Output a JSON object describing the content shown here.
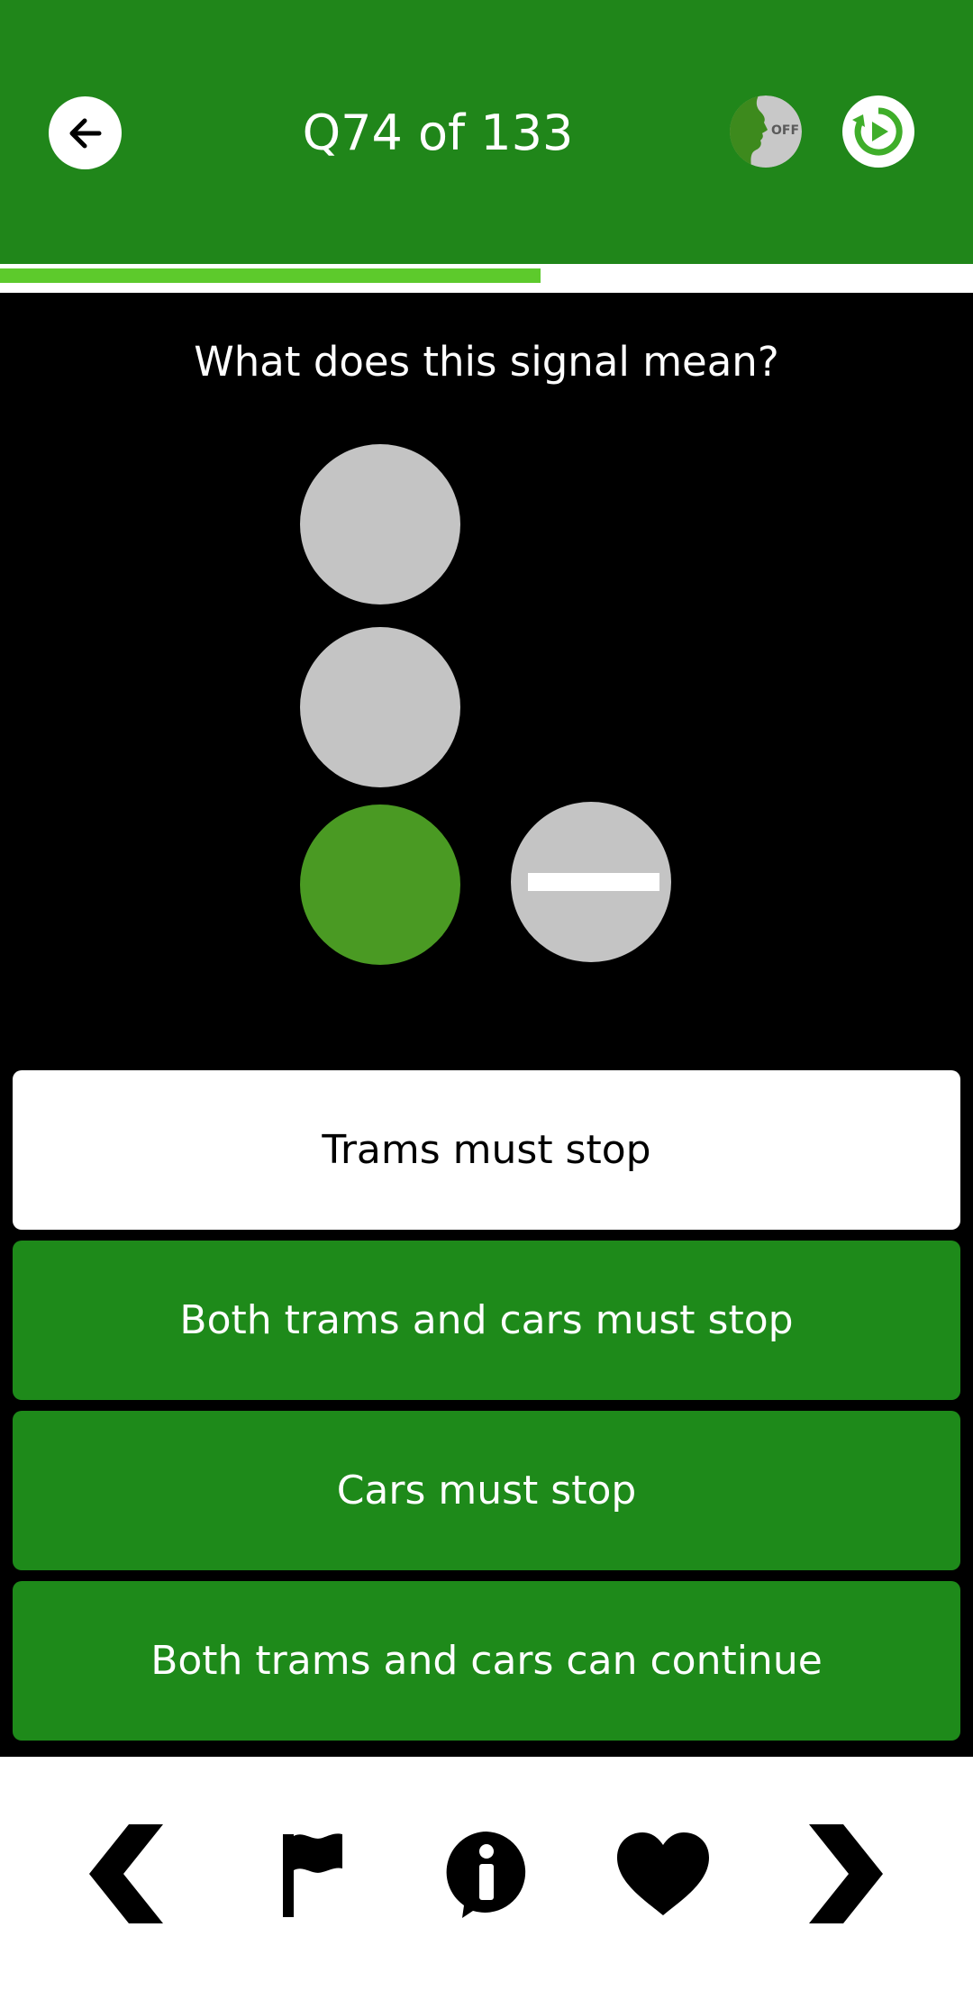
{
  "header": {
    "title": "Q74 of 133",
    "voice_toggle_label": "OFF",
    "background_color": "#20861a"
  },
  "progress": {
    "current": 74,
    "total": 133,
    "fraction": 0.556,
    "fill_color": "#5dca2c"
  },
  "question": {
    "text": "What does this signal mean?"
  },
  "signal": {
    "lights": [
      {
        "state": "off",
        "color": "#c4c4c4"
      },
      {
        "state": "off",
        "color": "#c4c4c4"
      },
      {
        "state": "on",
        "color": "#4a9a23"
      }
    ],
    "tram_signal": {
      "symbol": "horizontal-bar",
      "color": "#c4c4c4"
    }
  },
  "answers": [
    {
      "label": "Trams must stop",
      "selected": true
    },
    {
      "label": "Both trams and cars must stop",
      "selected": false
    },
    {
      "label": "Cars must stop",
      "selected": false
    },
    {
      "label": "Both trams and cars can continue",
      "selected": false
    }
  ],
  "bottom_nav": {
    "icons": [
      "chevron-left-icon",
      "flag-icon",
      "info-icon",
      "heart-icon",
      "chevron-right-icon"
    ]
  }
}
